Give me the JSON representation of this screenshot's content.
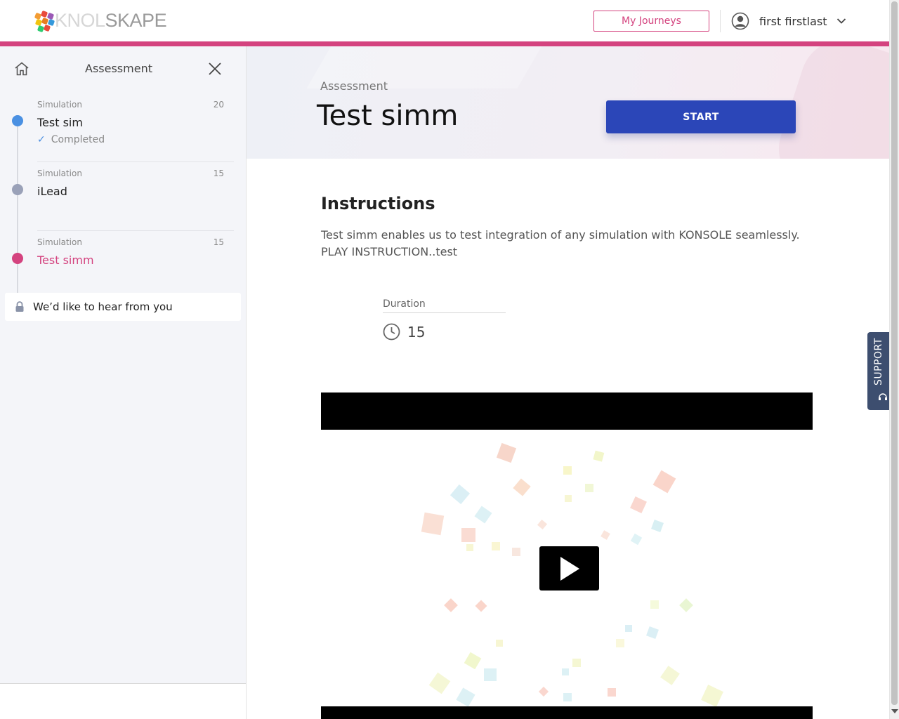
{
  "header": {
    "logo_text_light": "KNOL",
    "logo_text_dark": "SKAPE",
    "journeys_label": "My Journeys",
    "user_name": "first firstlast"
  },
  "sidebar": {
    "title": "Assessment",
    "items": [
      {
        "type": "Simulation",
        "count": "20",
        "name": "Test sim",
        "status": "Completed",
        "dot_color": "#4a90e2"
      },
      {
        "type": "Simulation",
        "count": "15",
        "name": "iLead",
        "status": "",
        "dot_color": "#9aa1b8"
      },
      {
        "type": "Simulation",
        "count": "15",
        "name": "Test simm",
        "status": "",
        "dot_color": "#d4437f"
      }
    ],
    "feedback_label": "We’d like to hear from you"
  },
  "main": {
    "subtitle": "Assessment",
    "title": "Test simm",
    "start_label": "START",
    "instructions_title": "Instructions",
    "instructions_text": "Test simm enables us to test integration of any simulation with KONSOLE seamlessly. PLAY INSTRUCTION..test",
    "duration_label": "Duration",
    "duration_value": "15"
  },
  "support": {
    "label": "SUPPORT"
  },
  "colors": {
    "accent": "#d4437f",
    "primary": "#2b46b8",
    "support_bg": "#3d4e6f"
  }
}
